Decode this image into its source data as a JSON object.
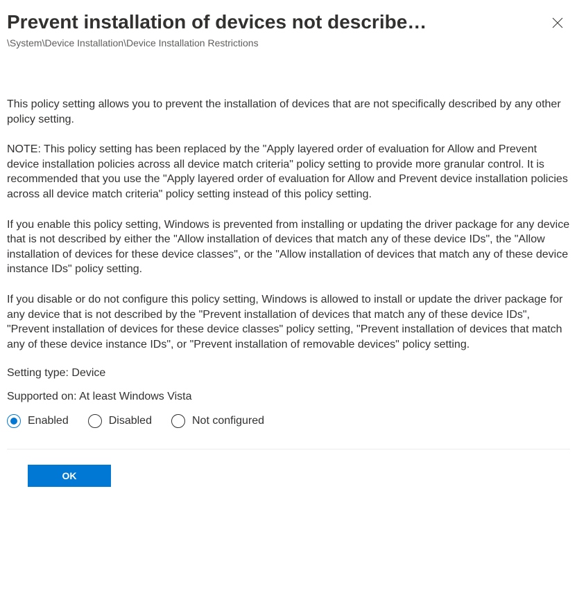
{
  "title": "Prevent installation of devices not describe…",
  "breadcrumb": "\\System\\Device Installation\\Device Installation Restrictions",
  "description": {
    "p1": "This policy setting allows you to prevent the installation of devices that are not specifically described by any other policy setting.",
    "p2": "NOTE: This policy setting has been replaced by the \"Apply layered order of evaluation for Allow and Prevent device installation policies across all device match criteria\" policy setting to provide more granular control. It is recommended that you use the \"Apply layered order of evaluation for Allow and Prevent device installation policies across all device match criteria\" policy setting instead of this policy setting.",
    "p3": "If you enable this policy setting, Windows is prevented from installing or updating the driver package for any device that is not described by either the \"Allow installation of devices that match any of these device IDs\", the \"Allow installation of devices for these device classes\", or the \"Allow installation of devices that match any of these device instance IDs\" policy setting.",
    "p4": "If you disable or do not configure this policy setting, Windows is allowed to install or update the driver package for any device that is not described by the \"Prevent installation of devices that match any of these device IDs\", \"Prevent installation of devices for these device classes\" policy setting, \"Prevent installation of devices that match any of these device instance IDs\", or \"Prevent installation of removable devices\" policy setting."
  },
  "meta": {
    "setting_type": "Setting type: Device",
    "supported_on": "Supported on: At least Windows Vista"
  },
  "options": {
    "enabled": {
      "label": "Enabled",
      "selected": true
    },
    "disabled": {
      "label": "Disabled",
      "selected": false
    },
    "not_configured": {
      "label": "Not configured",
      "selected": false
    }
  },
  "buttons": {
    "ok": "OK"
  }
}
